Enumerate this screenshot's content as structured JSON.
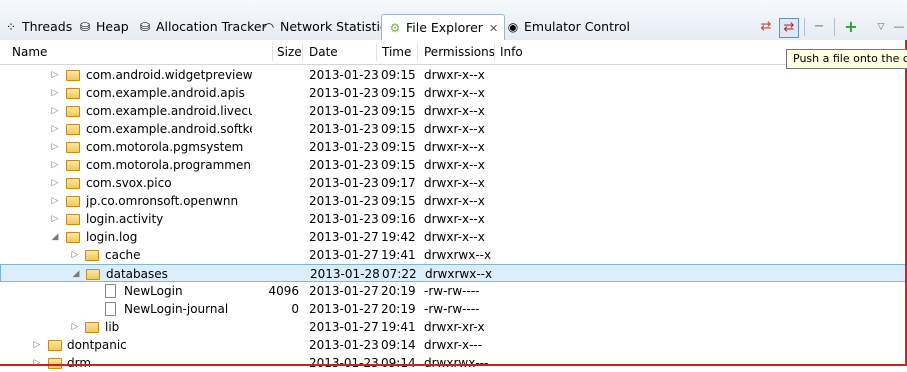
{
  "tabs": [
    {
      "label": "Threads",
      "icon": "threads-icon"
    },
    {
      "label": "Heap",
      "icon": "heap-icon"
    },
    {
      "label": "Allocation Tracker",
      "icon": "allocation-icon"
    },
    {
      "label": "Network Statistics",
      "icon": "wifi-icon"
    },
    {
      "label": "File Explorer",
      "icon": "android-icon",
      "active": true
    },
    {
      "label": "Emulator Control",
      "icon": "emulator-icon"
    }
  ],
  "tooltip": "Push a file onto the de",
  "columns": {
    "name": "Name",
    "size": "Size",
    "date": "Date",
    "time": "Time",
    "permissions": "Permissions",
    "info": "Info"
  },
  "rows": [
    {
      "name": "com.android.widgetpreview",
      "size": "",
      "date": "2013-01-23",
      "time": "09:15",
      "perm": "drwxr-x--x",
      "type": "folder",
      "expander": "collapsed"
    },
    {
      "name": "com.example.android.apis",
      "size": "",
      "date": "2013-01-23",
      "time": "09:15",
      "perm": "drwxr-x--x",
      "type": "folder",
      "expander": "collapsed"
    },
    {
      "name": "com.example.android.livecubes",
      "size": "",
      "date": "2013-01-23",
      "time": "09:15",
      "perm": "drwxr-x--x",
      "type": "folder",
      "expander": "collapsed"
    },
    {
      "name": "com.example.android.softkeybo",
      "size": "",
      "date": "2013-01-23",
      "time": "09:15",
      "perm": "drwxr-x--x",
      "type": "folder",
      "expander": "collapsed"
    },
    {
      "name": "com.motorola.pgmsystem",
      "size": "",
      "date": "2013-01-23",
      "time": "09:15",
      "perm": "drwxr-x--x",
      "type": "folder",
      "expander": "collapsed"
    },
    {
      "name": "com.motorola.programmenu",
      "size": "",
      "date": "2013-01-23",
      "time": "09:15",
      "perm": "drwxr-x--x",
      "type": "folder",
      "expander": "collapsed"
    },
    {
      "name": "com.svox.pico",
      "size": "",
      "date": "2013-01-23",
      "time": "09:17",
      "perm": "drwxr-x--x",
      "type": "folder",
      "expander": "collapsed"
    },
    {
      "name": "jp.co.omronsoft.openwnn",
      "size": "",
      "date": "2013-01-23",
      "time": "09:15",
      "perm": "drwxr-x--x",
      "type": "folder",
      "expander": "collapsed"
    },
    {
      "name": "login.activity",
      "size": "",
      "date": "2013-01-23",
      "time": "09:16",
      "perm": "drwxr-x--x",
      "type": "folder",
      "expander": "collapsed"
    },
    {
      "name": "login.log",
      "size": "",
      "date": "2013-01-27",
      "time": "19:42",
      "perm": "drwxr-x--x",
      "type": "folder",
      "expander": "expanded"
    },
    {
      "name": "cache",
      "size": "",
      "date": "2013-01-27",
      "time": "19:41",
      "perm": "drwxrwx--x",
      "type": "folder",
      "expander": "collapsed"
    },
    {
      "name": "databases",
      "size": "",
      "date": "2013-01-28",
      "time": "07:22",
      "perm": "drwxrwx--x",
      "type": "folder",
      "expander": "expanded",
      "selected": true
    },
    {
      "name": "NewLogin",
      "size": "4096",
      "date": "2013-01-27",
      "time": "20:19",
      "perm": "-rw-rw----",
      "type": "file",
      "expander": ""
    },
    {
      "name": "NewLogin-journal",
      "size": "0",
      "date": "2013-01-27",
      "time": "20:19",
      "perm": "-rw-rw----",
      "type": "file",
      "expander": ""
    },
    {
      "name": "lib",
      "size": "",
      "date": "2013-01-27",
      "time": "19:41",
      "perm": "drwxr-xr-x",
      "type": "folder",
      "expander": "collapsed"
    },
    {
      "name": "dontpanic",
      "size": "",
      "date": "2013-01-23",
      "time": "09:14",
      "perm": "drwxr-x---",
      "type": "folder",
      "expander": "collapsed"
    },
    {
      "name": "drm",
      "size": "",
      "date": "2013-01-23",
      "time": "09:14",
      "perm": "drwxrwx---",
      "type": "folder",
      "expander": "collapsed"
    }
  ]
}
